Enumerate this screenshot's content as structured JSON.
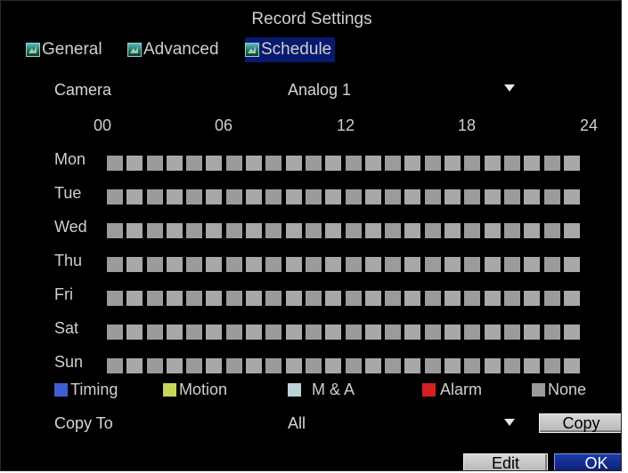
{
  "title": "Record Settings",
  "tabs": [
    {
      "label": "General",
      "icon": "tab-image-icon"
    },
    {
      "label": "Advanced",
      "icon": "tab-image-icon"
    },
    {
      "label": "Schedule",
      "icon": "tab-image-icon",
      "active": true
    }
  ],
  "camera": {
    "label": "Camera",
    "value": "Analog 1"
  },
  "hours": [
    "00",
    "06",
    "12",
    "18",
    "24"
  ],
  "days": [
    "Mon",
    "Tue",
    "Wed",
    "Thu",
    "Fri",
    "Sat",
    "Sun"
  ],
  "slots_per_day": 24,
  "legend": [
    {
      "label": "Timing",
      "color": "#3f5fcf"
    },
    {
      "label": "Motion",
      "color": "#c7d65a"
    },
    {
      "label": "M & A",
      "color": "#b9d3d7"
    },
    {
      "label": "Alarm",
      "color": "#d42020"
    },
    {
      "label": "None",
      "color": "#9b9b9b"
    }
  ],
  "copy_to": {
    "label": "Copy To",
    "value": "All",
    "button": "Copy"
  },
  "buttons": {
    "edit": "Edit",
    "ok": "OK"
  }
}
